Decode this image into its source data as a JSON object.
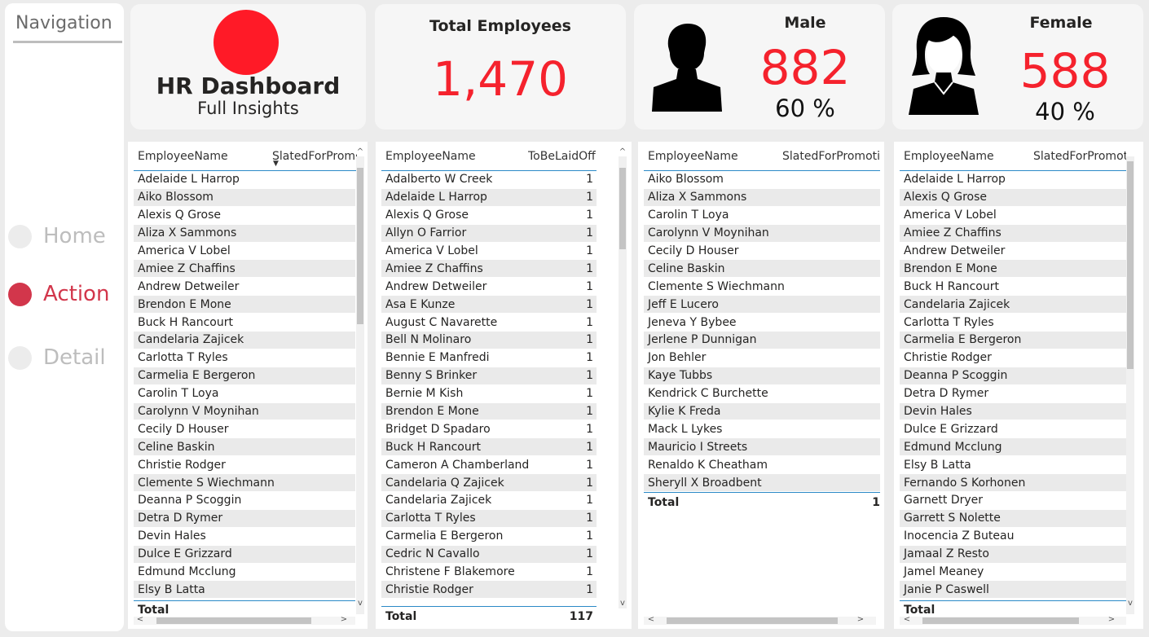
{
  "navigation": {
    "title": "Navigation",
    "items": [
      {
        "label": "Home",
        "active": false
      },
      {
        "label": "Action",
        "active": true
      },
      {
        "label": "Detail",
        "active": false
      }
    ]
  },
  "header": {
    "title": "HR Dashboard",
    "subtitle": "Full Insights",
    "logo_color": "#ff1a27"
  },
  "kpis": {
    "total": {
      "label": "Total Employees",
      "value": "1,470"
    },
    "male": {
      "label": "Male",
      "value": "882",
      "pct": "60 %",
      "icon": "male-person-icon"
    },
    "female": {
      "label": "Female",
      "value": "588",
      "pct": "40 %",
      "icon": "female-person-icon"
    }
  },
  "colors": {
    "accent": "#f5222d",
    "nav_active": "#d2364b",
    "header_line": "#2b8ac7"
  },
  "tables": {
    "promo_all": {
      "col_name": "EmployeeName",
      "col_value": "SlatedForPromotion",
      "rows": [
        "Adelaide L Harrop",
        "Aiko Blossom",
        "Alexis Q Grose",
        "Aliza X Sammons",
        "America V Lobel",
        "Amiee Z Chaffins",
        "Andrew Detweiler",
        "Brendon E Mone",
        "Buck H Rancourt",
        "Candelaria Zajicek",
        "Carlotta T Ryles",
        "Carmelia E Bergeron",
        "Carolin T Loya",
        "Carolynn V Moynihan",
        "Cecily D Houser",
        "Celine Baskin",
        "Christie Rodger",
        "Clemente S Wiechmann",
        "Deanna P Scoggin",
        "Detra D Rymer",
        "Devin Hales",
        "Dulce E Grizzard",
        "Edmund Mcclung",
        "Elsy B Latta"
      ],
      "total_label": "Total"
    },
    "laidoff": {
      "col_name": "EmployeeName",
      "col_value": "ToBeLaidOff",
      "rows": [
        {
          "name": "Adalberto W Creek",
          "value": "1"
        },
        {
          "name": "Adelaide L Harrop",
          "value": "1"
        },
        {
          "name": "Alexis Q Grose",
          "value": "1"
        },
        {
          "name": "Allyn O Farrior",
          "value": "1"
        },
        {
          "name": "America V Lobel",
          "value": "1"
        },
        {
          "name": "Amiee Z Chaffins",
          "value": "1"
        },
        {
          "name": "Andrew Detweiler",
          "value": "1"
        },
        {
          "name": "Asa E Kunze",
          "value": "1"
        },
        {
          "name": "August C Navarette",
          "value": "1"
        },
        {
          "name": "Bell N Molinaro",
          "value": "1"
        },
        {
          "name": "Bennie E Manfredi",
          "value": "1"
        },
        {
          "name": "Benny S Brinker",
          "value": "1"
        },
        {
          "name": "Bernie M Kish",
          "value": "1"
        },
        {
          "name": "Brendon E Mone",
          "value": "1"
        },
        {
          "name": "Bridget D Spadaro",
          "value": "1"
        },
        {
          "name": "Buck H Rancourt",
          "value": "1"
        },
        {
          "name": "Cameron A Chamberland",
          "value": "1"
        },
        {
          "name": "Candelaria Q Zajicek",
          "value": "1"
        },
        {
          "name": "Candelaria Zajicek",
          "value": "1"
        },
        {
          "name": "Carlotta T Ryles",
          "value": "1"
        },
        {
          "name": "Carmelia E Bergeron",
          "value": "1"
        },
        {
          "name": "Cedric N Cavallo",
          "value": "1"
        },
        {
          "name": "Christene F Blakemore",
          "value": "1"
        },
        {
          "name": "Christie Rodger",
          "value": "1"
        }
      ],
      "total_label": "Total",
      "total_value": "117"
    },
    "promo_male": {
      "col_name": "EmployeeName",
      "col_value": "SlatedForPromotion",
      "rows": [
        "Aiko Blossom",
        "Aliza X Sammons",
        "Carolin T Loya",
        "Carolynn V Moynihan",
        "Cecily D Houser",
        "Celine Baskin",
        "Clemente S Wiechmann",
        "Jeff E Lucero",
        "Jeneva Y Bybee",
        "Jerlene P Dunnigan",
        "Jon Behler",
        "Kaye Tubbs",
        "Kendrick C Burchette",
        "Kylie K Freda",
        "Mack L Lykes",
        "Mauricio I Streets",
        "Renaldo K Cheatham",
        "Sheryll X Broadbent"
      ],
      "total_label": "Total",
      "total_value": "1"
    },
    "promo_female": {
      "col_name": "EmployeeName",
      "col_value": "SlatedForPromotion",
      "rows": [
        "Adelaide L Harrop",
        "Alexis Q Grose",
        "America V Lobel",
        "Amiee Z Chaffins",
        "Andrew Detweiler",
        "Brendon E Mone",
        "Buck H Rancourt",
        "Candelaria Zajicek",
        "Carlotta T Ryles",
        "Carmelia E Bergeron",
        "Christie Rodger",
        "Deanna P Scoggin",
        "Detra D Rymer",
        "Devin Hales",
        "Dulce E Grizzard",
        "Edmund Mcclung",
        "Elsy B Latta",
        "Fernando S Korhonen",
        "Garnett Dryer",
        "Garrett S Nolette",
        "Inocencia Z Buteau",
        "Jamaal Z Resto",
        "Jamel Meaney",
        "Janie P Caswell"
      ],
      "total_label": "Total"
    }
  }
}
